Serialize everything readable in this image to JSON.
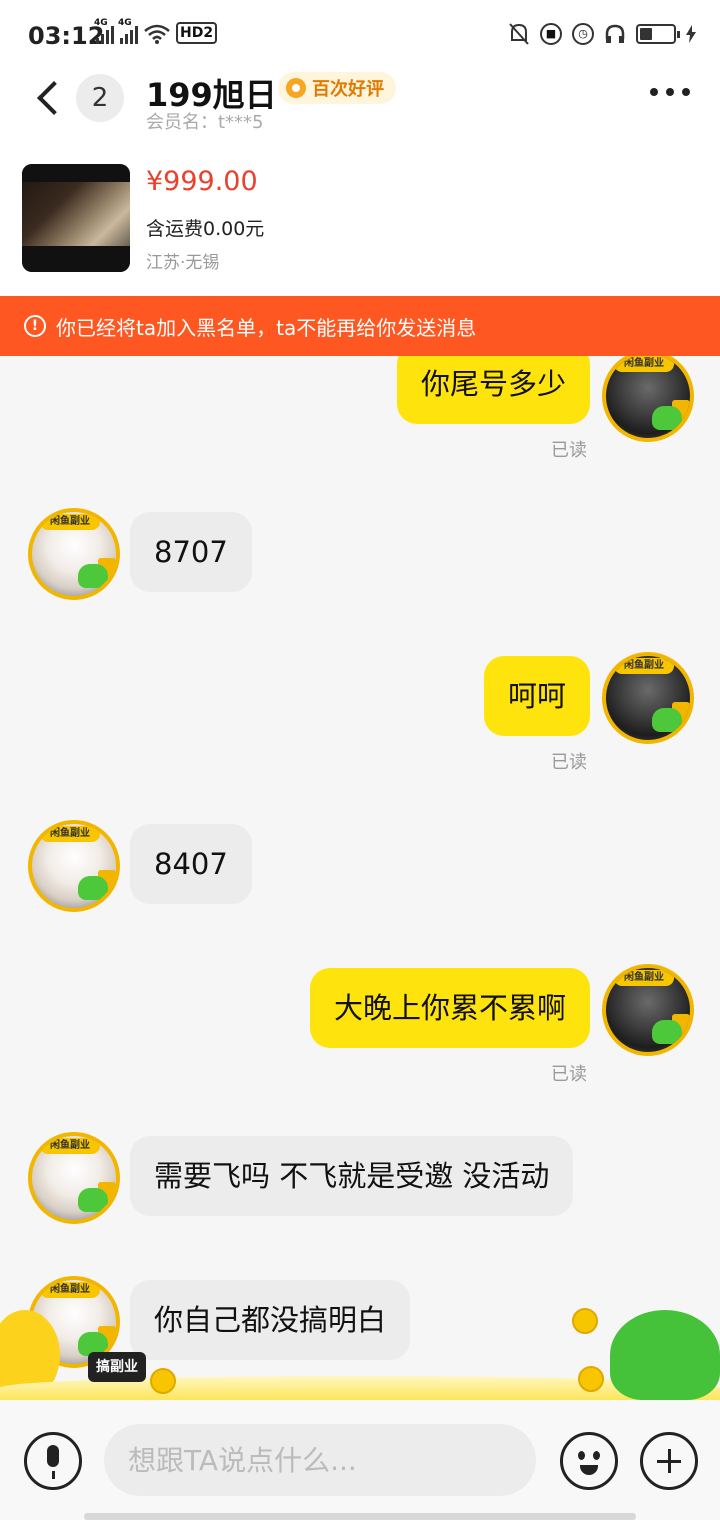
{
  "status_bar": {
    "time": "03:12",
    "network1": "4G",
    "network2": "4G",
    "hd": "HD2"
  },
  "header": {
    "back_icon": "chevron-left-icon",
    "unread_count": "2",
    "title": "199旭日",
    "badge": "百次好评",
    "member": "会员名：t***5",
    "more_icon": "more-dots-icon"
  },
  "product": {
    "price": "¥999.00",
    "shipping": "含运费0.00元",
    "location": "江苏·无锡"
  },
  "banner": {
    "icon": "warning-icon",
    "text": "你已经将ta加入黑名单，ta不能再给你发送消息"
  },
  "messages": [
    {
      "from": "me",
      "text": "你尾号多少",
      "status": "已读"
    },
    {
      "from": "other",
      "text": "8707"
    },
    {
      "from": "me",
      "text": "呵呵",
      "status": "已读"
    },
    {
      "from": "other",
      "text": "8407"
    },
    {
      "from": "me",
      "text": "大晚上你累不累啊",
      "status": "已读"
    },
    {
      "from": "other",
      "text": "需要飞吗 不飞就是受邀 没活动"
    },
    {
      "from": "other",
      "text": "你自己都没搞明白"
    }
  ],
  "avatar_tag": "闲鱼副业",
  "promo_tag": "搞副业",
  "input": {
    "placeholder": "想跟TA说点什么..."
  },
  "colors": {
    "accent_yellow": "#ffe30d",
    "banner_orange": "#ff5722",
    "price_red": "#e8412c"
  }
}
